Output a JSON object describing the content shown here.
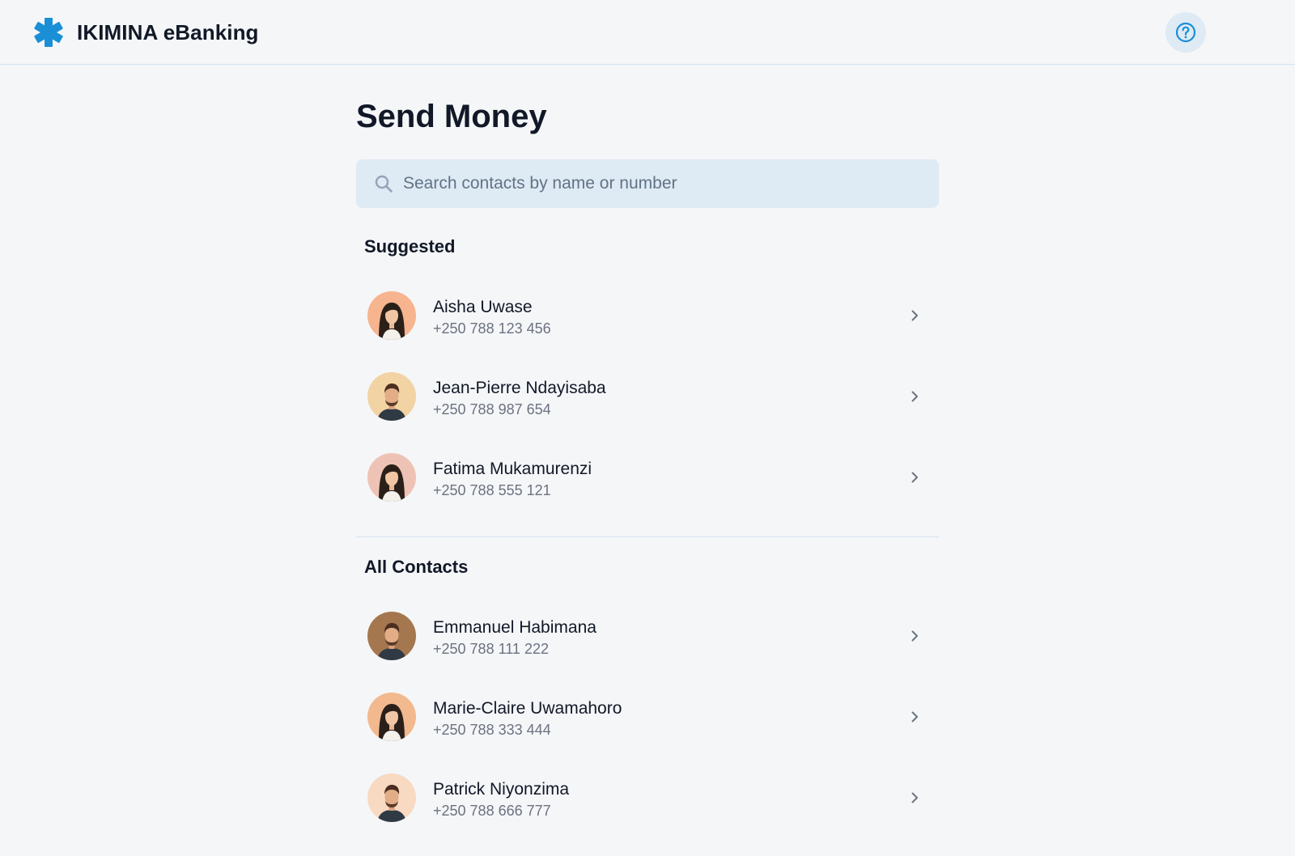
{
  "app": {
    "title": "IKIMINA eBanking",
    "brand_icon": "asterisk-logo-icon",
    "help_icon": "help-circle-icon",
    "accent_color": "#1a8fd6"
  },
  "page": {
    "title": "Send Money"
  },
  "search": {
    "placeholder": "Search contacts by name or number",
    "value": "",
    "icon": "search-icon"
  },
  "suggested": {
    "heading": "Suggested",
    "contacts": [
      {
        "name": "Aisha Uwase",
        "phone": "+250 788 123 456",
        "avatar": "female"
      },
      {
        "name": "Jean-Pierre Ndayisaba",
        "phone": "+250 788 987 654",
        "avatar": "male"
      },
      {
        "name": "Fatima Mukamurenzi",
        "phone": "+250 788 555 121",
        "avatar": "female"
      }
    ]
  },
  "all_contacts": {
    "heading": "All Contacts",
    "contacts": [
      {
        "name": "Emmanuel Habimana",
        "phone": "+250 788 111 222",
        "avatar": "male"
      },
      {
        "name": "Marie-Claire Uwamahoro",
        "phone": "+250 788 333 444",
        "avatar": "female"
      },
      {
        "name": "Patrick Niyonzima",
        "phone": "+250 788 666 777",
        "avatar": "male"
      }
    ]
  }
}
